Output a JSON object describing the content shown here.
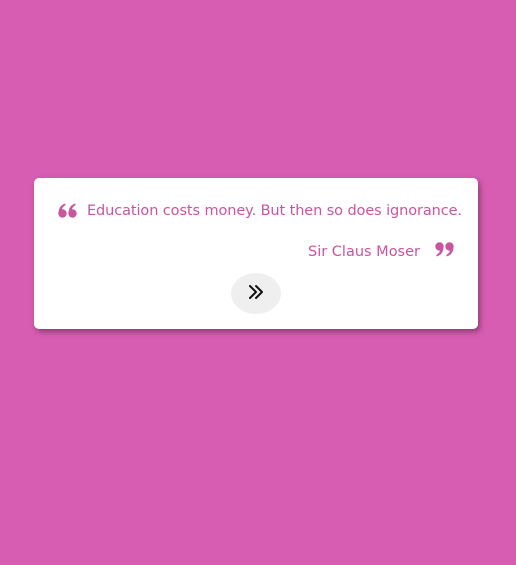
{
  "colors": {
    "background": "#d65db1",
    "card": "#ffffff",
    "accent": "#c9559f",
    "button_bg": "#efefef"
  },
  "quote": {
    "text": "Education costs money. But then so does ignorance.",
    "author": "Sir Claus Moser",
    "open_icon": "quote-left-icon",
    "close_icon": "quote-right-icon"
  },
  "next_button": {
    "icon": "double-chevron-right-icon"
  }
}
